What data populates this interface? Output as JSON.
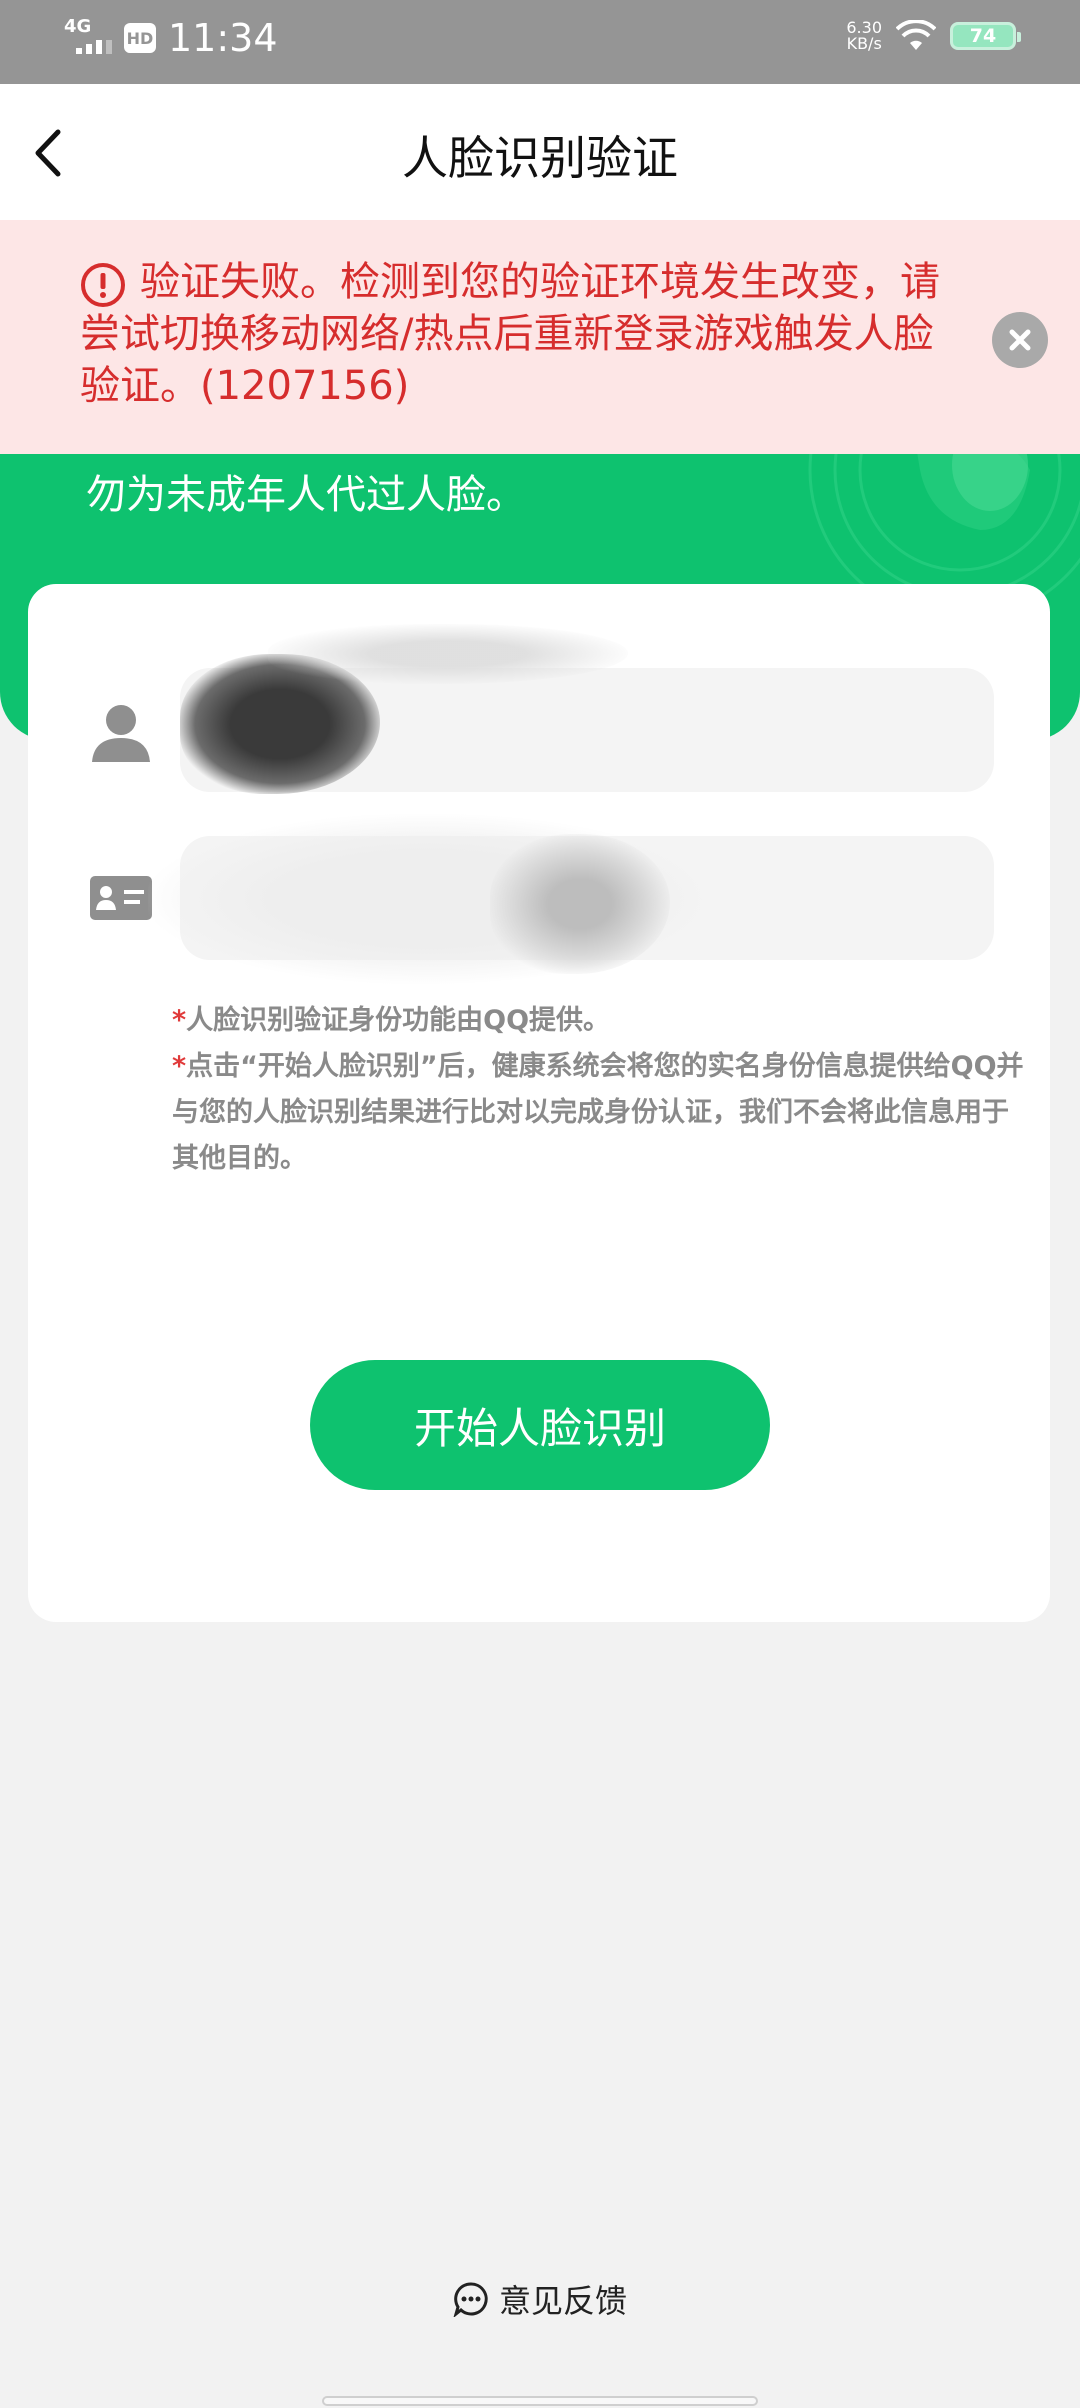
{
  "status_bar": {
    "network": "4G",
    "hd": "HD",
    "time": "11:34",
    "speed_value": "6.30",
    "speed_unit": "KB/s",
    "battery": "74"
  },
  "header": {
    "title": "人脸识别验证"
  },
  "alert": {
    "message": "验证失败。检测到您的验证环境发生改变，请尝试切换移动网络/热点后重新登录游戏触发人脸验证。(1207156)"
  },
  "banner": {
    "text": "勿为未成年人代过人脸。"
  },
  "form": {
    "name_value": "",
    "id_value": ""
  },
  "notes": {
    "star": "*",
    "line1": "人脸识别验证身份功能由QQ提供。",
    "line2": "点击“开始人脸识别”后，健康系统会将您的实名身份信息提供给QQ并与您的人脸识别结果进行比对以完成身份认证，我们不会将此信息用于其他目的。"
  },
  "start_button": {
    "label": "开始人脸识别"
  },
  "feedback": {
    "label": "意见反馈"
  },
  "colors": {
    "brand_green": "#0ec26f",
    "error_red": "#d62d2d",
    "alert_bg": "#fde6e6"
  }
}
